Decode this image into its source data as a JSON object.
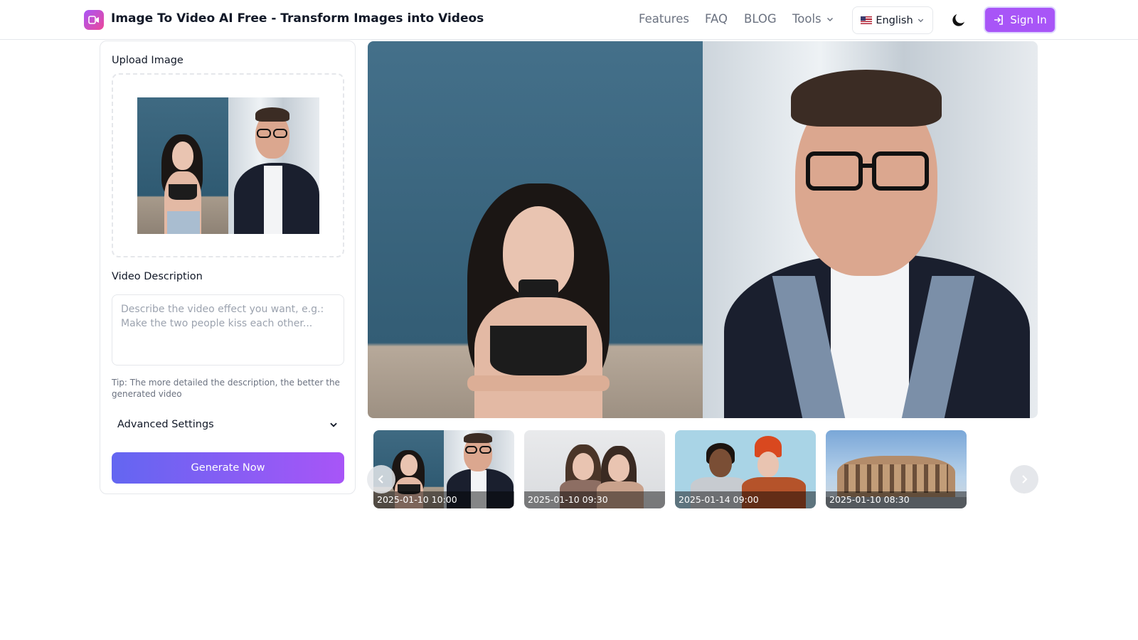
{
  "header": {
    "title": "Image To Video AI Free - Transform Images into Videos",
    "nav": {
      "features": "Features",
      "faq": "FAQ",
      "blog": "BLOG",
      "tools": "Tools"
    },
    "language": "English",
    "sign_in": "Sign In"
  },
  "panel": {
    "upload_label": "Upload Image",
    "description_label": "Video Description",
    "description_placeholder": "Describe the video effect you want, e.g.: Make the two people kiss each other...",
    "description_value": "",
    "tip": "Tip: The more detailed the description, the better the generated video",
    "advanced_settings": "Advanced Settings",
    "generate": "Generate Now"
  },
  "gallery": {
    "items": [
      {
        "date": "2025-01-10 10:00"
      },
      {
        "date": "2025-01-10 09:30"
      },
      {
        "date": "2025-01-14 09:00"
      },
      {
        "date": "2025-01-10 08:30"
      }
    ]
  },
  "colors": {
    "accent": "#a855f7",
    "gradient_start": "#6366f1",
    "gradient_end": "#a855f7"
  },
  "icons": {
    "logo": "video-icon",
    "tools_dropdown": "chevron-down-icon",
    "language_dropdown": "chevron-down-icon",
    "theme": "moon-icon",
    "sign_in": "login-icon",
    "advanced": "chevron-down-icon",
    "prev": "chevron-left-icon",
    "next": "chevron-right-icon"
  }
}
